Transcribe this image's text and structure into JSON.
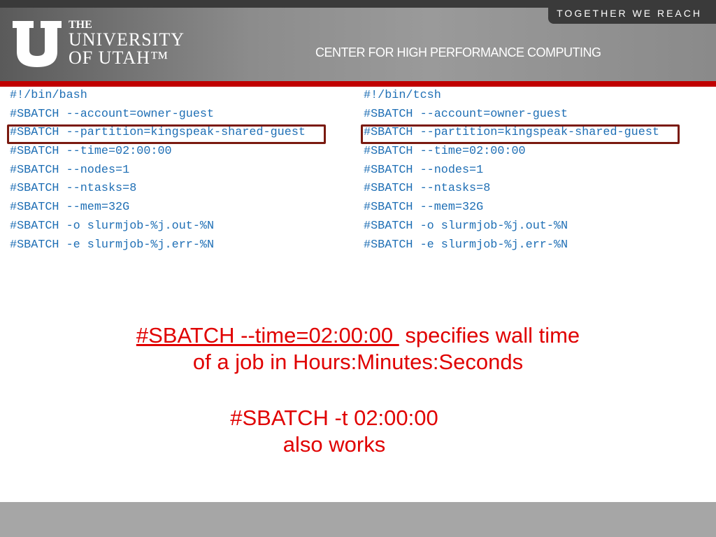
{
  "header": {
    "tagline": "TOGETHER WE REACH",
    "logo_text": [
      "THE",
      "UNIVERSITY",
      "OF UTAH™"
    ],
    "center_title": "CENTER FOR HIGH PERFORMANCE COMPUTING"
  },
  "left_script": [
    "#!/bin/bash",
    "#SBATCH --account=owner-guest",
    "#SBATCH --partition=kingspeak-shared-guest",
    "#SBATCH --time=02:00:00",
    "#SBATCH --nodes=1",
    "#SBATCH --ntasks=8",
    "#SBATCH --mem=32G",
    "#SBATCH -o slurmjob-%j.out-%N",
    "#SBATCH -e slurmjob-%j.err-%N"
  ],
  "right_script": [
    "#!/bin/tcsh",
    "#SBATCH --account=owner-guest",
    "#SBATCH --partition=kingspeak-shared-guest",
    "#SBATCH --time=02:00:00",
    "#SBATCH --nodes=1",
    "#SBATCH --ntasks=8",
    "#SBATCH --mem=32G",
    "#SBATCH -o slurmjob-%j.out-%N",
    "#SBATCH -e slurmjob-%j.err-%N"
  ],
  "note1": {
    "underlined": "#SBATCH --time=02:00:00 ",
    "rest": " specifies wall time",
    "line2": "of a job in Hours:Minutes:Seconds"
  },
  "note2": {
    "line1": "#SBATCH -t 02:00:00",
    "line2": "also works"
  },
  "colors": {
    "code": "#1f6fb5",
    "highlight_box": "#7a1a10",
    "note_text": "#e00000",
    "brand_red": "#c00000"
  }
}
